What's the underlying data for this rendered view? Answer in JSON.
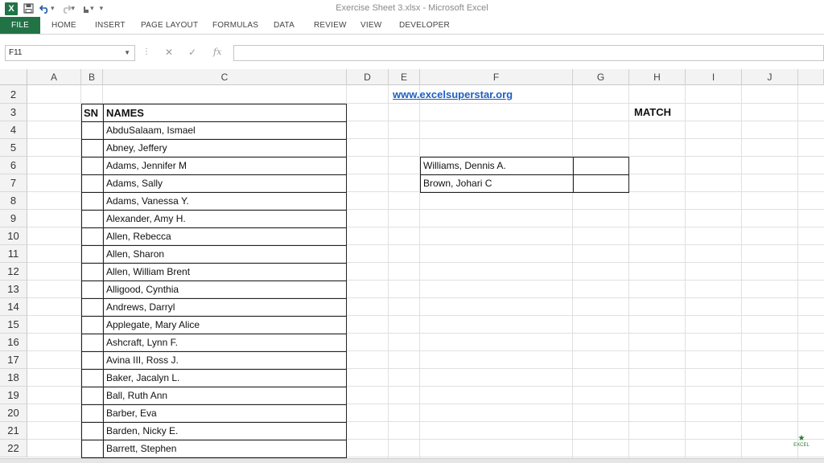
{
  "window": {
    "title": "Exercise Sheet 3.xlsx - Microsoft Excel"
  },
  "qat": {
    "logo": "X"
  },
  "ribbon": {
    "tabs": [
      "FILE",
      "HOME",
      "INSERT",
      "PAGE LAYOUT",
      "FORMULAS",
      "DATA",
      "REVIEW",
      "VIEW",
      "DEVELOPER"
    ]
  },
  "formula_bar": {
    "name_box": "F11",
    "fx": "fx",
    "formula": ""
  },
  "columns": [
    "A",
    "B",
    "C",
    "D",
    "E",
    "F",
    "G",
    "H",
    "I",
    "J"
  ],
  "rows": [
    "2",
    "3",
    "4",
    "5",
    "6",
    "7",
    "8",
    "9",
    "10",
    "11",
    "12",
    "13",
    "14",
    "15",
    "16",
    "17",
    "18",
    "19",
    "20",
    "21",
    "22"
  ],
  "sheet": {
    "link": "www.excelsuperstar.org",
    "sn_header": "SN",
    "names_header": "NAMES",
    "match_label": "MATCH",
    "names": [
      "AbduSalaam, Ismael",
      "Abney, Jeffery",
      "Adams, Jennifer M",
      "Adams, Sally",
      "Adams, Vanessa Y.",
      "Alexander, Amy H.",
      "Allen, Rebecca",
      "Allen, Sharon",
      "Allen, William Brent",
      "Alligood, Cynthia",
      "Andrews, Darryl",
      "Applegate, Mary Alice",
      "Ashcraft, Lynn F.",
      "Avina III, Ross J.",
      "Baker, Jacalyn L.",
      "Ball, Ruth Ann",
      "Barber, Eva",
      "Barden, Nicky E.",
      "Barrett, Stephen"
    ],
    "lookup": [
      "Williams, Dennis A.",
      "Brown, Johari C"
    ]
  },
  "watermark": "EXCEL"
}
